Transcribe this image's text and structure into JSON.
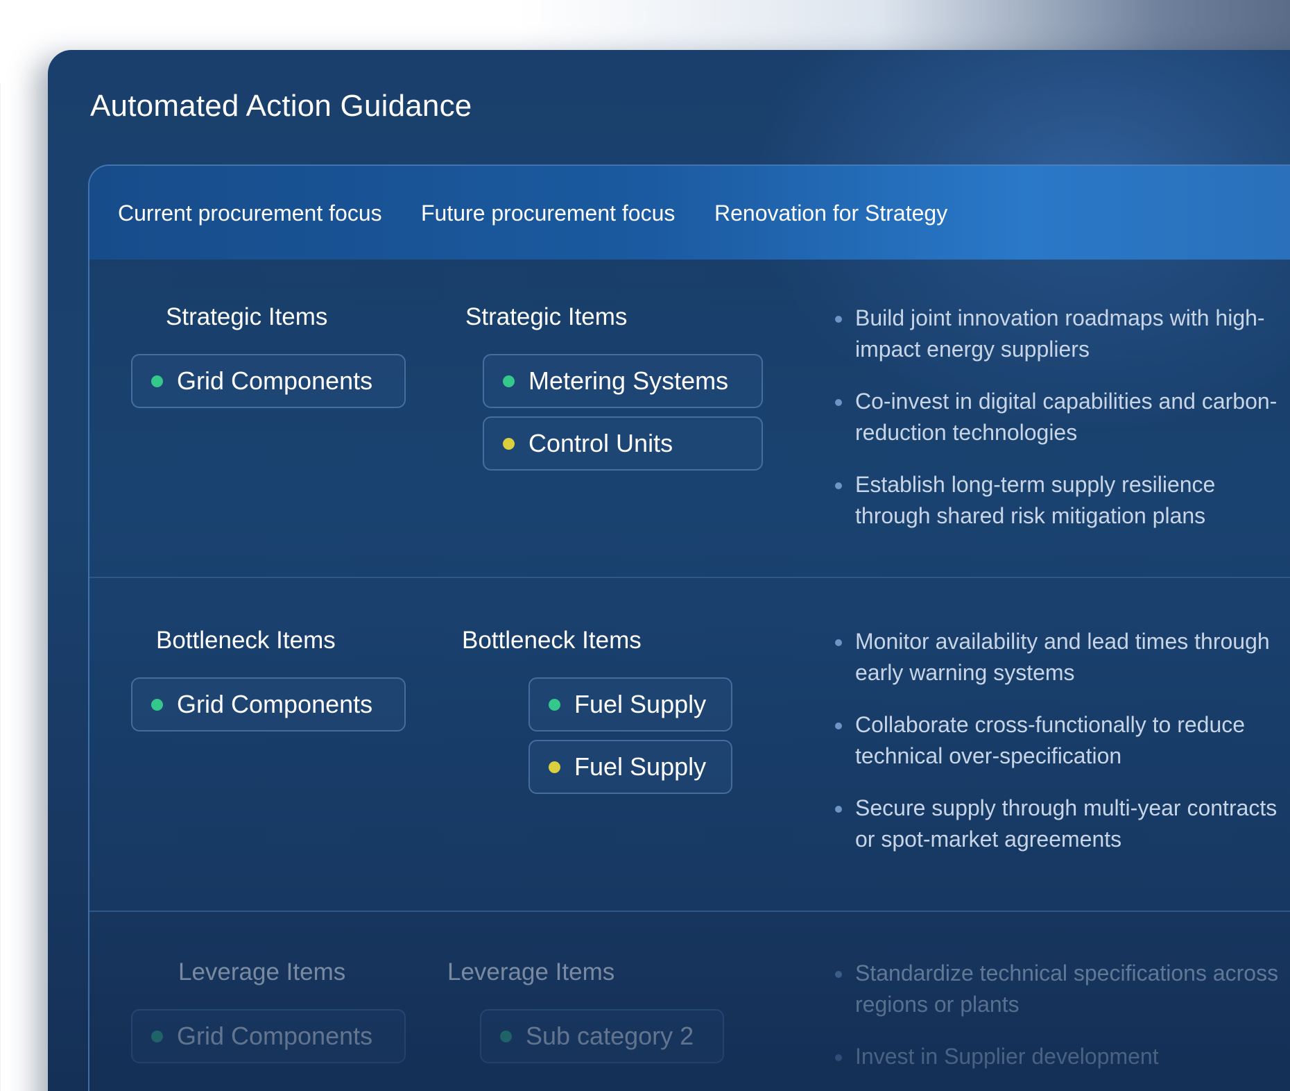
{
  "panel": {
    "title": "Automated Action Guidance"
  },
  "table": {
    "headers": [
      "Current procurement focus",
      "Future procurement focus",
      "Renovation for Strategy"
    ],
    "rows": [
      {
        "current": {
          "title": "Strategic Items",
          "items": [
            {
              "label": "Grid Components",
              "status_color": "#34c98b"
            }
          ]
        },
        "future": {
          "title": "Strategic Items",
          "items": [
            {
              "label": "Metering Systems",
              "status_color": "#34c98b"
            },
            {
              "label": "Control Units",
              "status_color": "#d9cf3f"
            }
          ]
        },
        "strategy": [
          "Build joint innovation roadmaps with high-impact energy suppliers",
          "Co-invest in digital capabilities and carbon-reduction technologies",
          "Establish long-term supply resilience through shared risk mitigation plans"
        ]
      },
      {
        "current": {
          "title": "Bottleneck Items",
          "items": [
            {
              "label": "Grid Components",
              "status_color": "#34c98b"
            }
          ]
        },
        "future": {
          "title": "Bottleneck Items",
          "items": [
            {
              "label": "Fuel Supply",
              "status_color": "#34c98b"
            },
            {
              "label": "Fuel Supply",
              "status_color": "#d9cf3f"
            }
          ]
        },
        "strategy": [
          "Monitor availability and lead times through early warning systems",
          "Collaborate cross-functionally to reduce technical over-specification",
          "Secure supply through multi-year contracts or spot-market agreements"
        ]
      },
      {
        "current": {
          "title": "Leverage Items",
          "items": [
            {
              "label": "Grid Components",
              "status_color": "#34c98b"
            }
          ]
        },
        "future": {
          "title": "Leverage Items",
          "items": [
            {
              "label": "Sub category 2",
              "status_color": "#34c98b"
            }
          ]
        },
        "strategy": [
          "Standardize technical specifications across regions or plants",
          "Invest in Supplier development"
        ]
      }
    ]
  }
}
